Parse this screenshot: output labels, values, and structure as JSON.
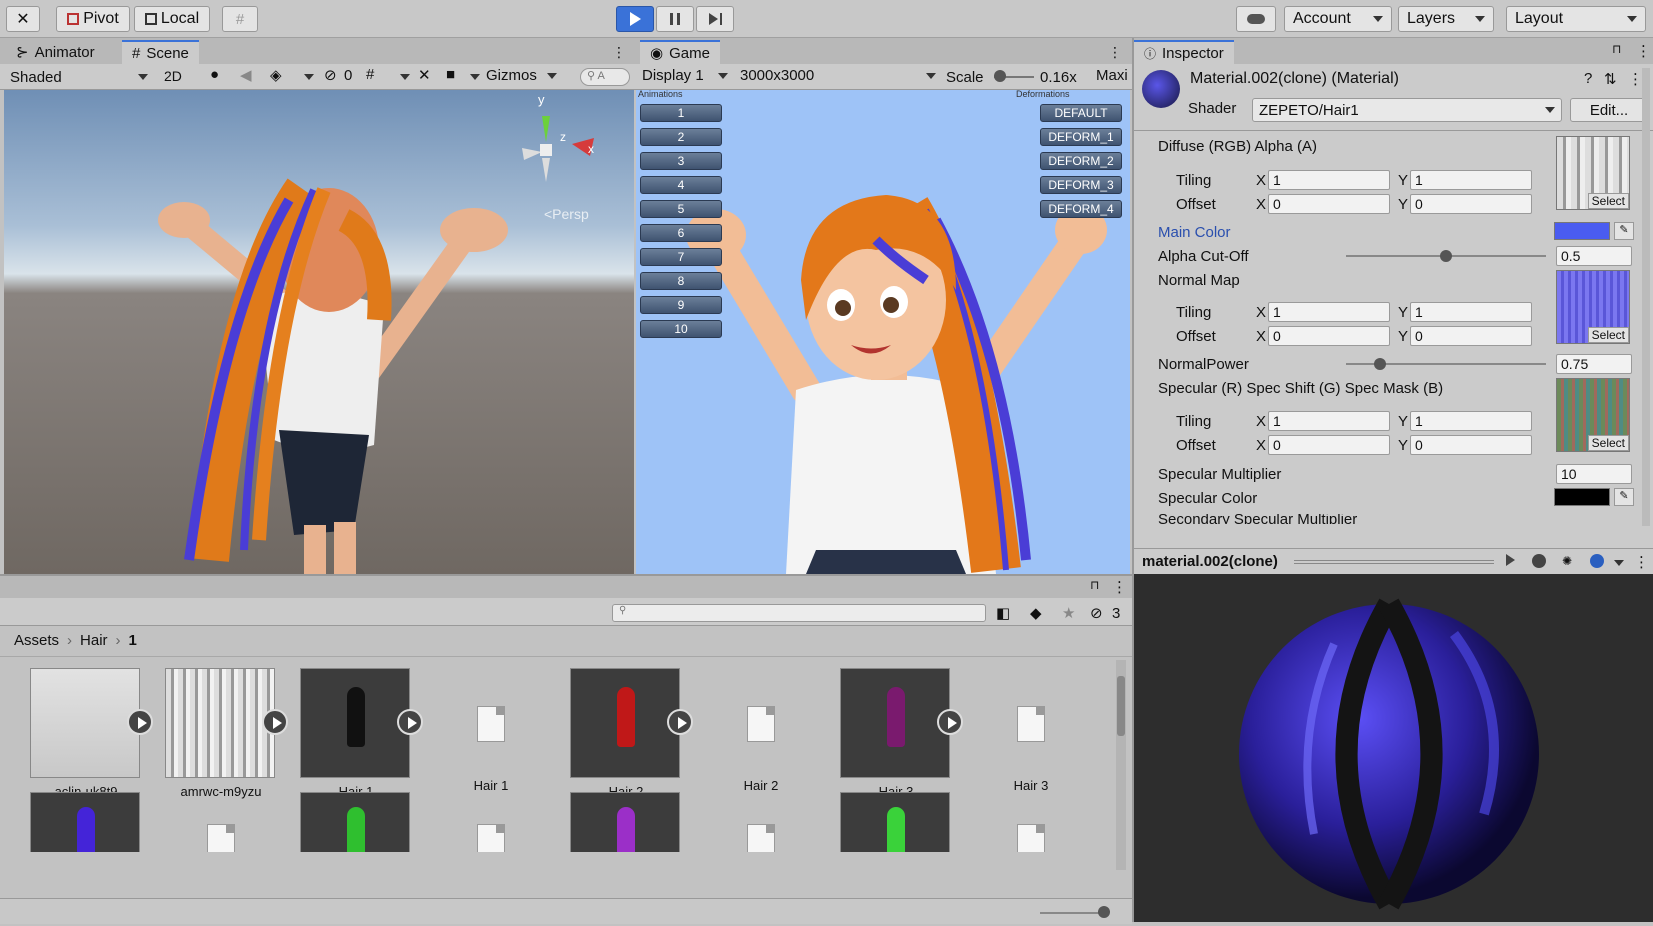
{
  "toolbar": {
    "pivot_label": "Pivot",
    "local_label": "Local",
    "account_label": "Account",
    "layers_label": "Layers",
    "layout_label": "Layout"
  },
  "scene_panel": {
    "tab_animator": "Animator",
    "tab_scene": "Scene",
    "shading_mode": "Shaded",
    "mode_2d": "2D",
    "hidden_count": "0",
    "gizmos_label": "Gizmos",
    "persp_label": "<Persp",
    "axis_y": "y",
    "axis_x": "x",
    "axis_z": "z"
  },
  "game_panel": {
    "tab_game": "Game",
    "display": "Display 1",
    "resolution": "3000x3000",
    "scale_label": "Scale",
    "scale_value": "0.16x",
    "maximize": "Maxi",
    "animations_header": "Animations",
    "deformations_header": "Deformations",
    "animation_buttons": [
      "1",
      "2",
      "3",
      "4",
      "5",
      "6",
      "7",
      "8",
      "9",
      "10"
    ],
    "deform_buttons": [
      "DEFAULT",
      "DEFORM_1",
      "DEFORM_2",
      "DEFORM_3",
      "DEFORM_4"
    ]
  },
  "inspector": {
    "tab_label": "Inspector",
    "material_name": "Material.002(clone) (Material)",
    "shader_label": "Shader",
    "shader_value": "ZEPETO/Hair1",
    "edit_label": "Edit...",
    "select_label": "Select",
    "tiling_label": "Tiling",
    "offset_label": "Offset",
    "x": "X",
    "y": "Y",
    "diffuse_label": "Diffuse (RGB) Alpha (A)",
    "diffuse_tiling": [
      "1",
      "1"
    ],
    "diffuse_offset": [
      "0",
      "0"
    ],
    "main_color_label": "Main Color",
    "main_color": "#4a5cf0",
    "alpha_cutoff_label": "Alpha Cut-Off",
    "alpha_cutoff_value": "0.5",
    "alpha_cutoff_fraction": 0.5,
    "normal_map_label": "Normal Map",
    "normal_tiling": [
      "1",
      "1"
    ],
    "normal_offset": [
      "0",
      "0"
    ],
    "normal_power_label": "NormalPower",
    "normal_power_value": "0.75",
    "normal_power_fraction": 0.17,
    "specular_label": "Specular (R) Spec Shift (G) Spec Mask (B)",
    "specular_tiling": [
      "1",
      "1"
    ],
    "specular_offset": [
      "0",
      "0"
    ],
    "spec_multiplier_label": "Specular Multiplier",
    "spec_multiplier_value": "10",
    "spec_color_label": "Specular Color",
    "spec_color": "#000000",
    "secondary_label": "Secondary Specular Multiplier",
    "preview_title": "material.002(clone)"
  },
  "project": {
    "breadcrumb": [
      "Assets",
      "Hair",
      "1"
    ],
    "hidden_count": "3",
    "assets_row1": [
      {
        "name": "aclin-uk8t9",
        "kind": "texture-light"
      },
      {
        "name": "amrwc-m9yzu",
        "kind": "texture-stripes"
      },
      {
        "name": "Hair 1",
        "kind": "prefab",
        "color": "#111111"
      },
      {
        "name": "Hair 1",
        "kind": "file"
      },
      {
        "name": "Hair 2",
        "kind": "prefab",
        "color": "#c01818"
      },
      {
        "name": "Hair 2",
        "kind": "file"
      },
      {
        "name": "Hair 3",
        "kind": "prefab",
        "color": "#7a1a6e"
      },
      {
        "name": "Hair 3",
        "kind": "file"
      }
    ],
    "assets_row2_colors": [
      "#4424d8",
      "#2fbf2f",
      "#9b2fc8",
      "#3ad23a"
    ]
  }
}
